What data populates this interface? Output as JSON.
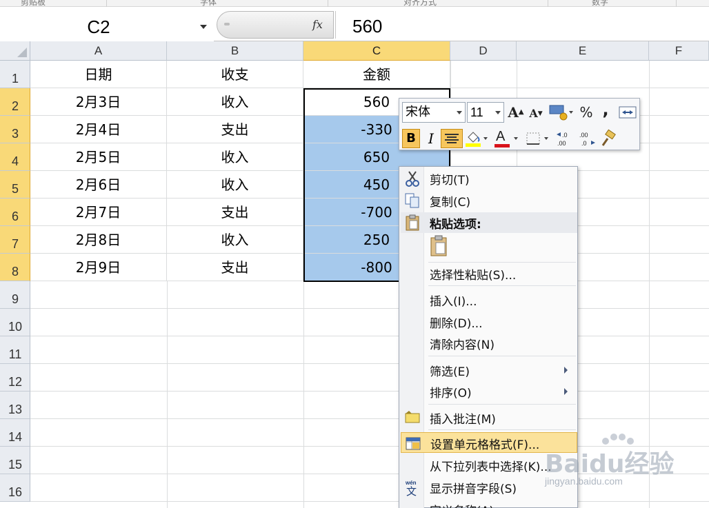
{
  "ribbon": {
    "groups": [
      "剪贴板",
      "字体",
      "对齐方式",
      "数字"
    ]
  },
  "formula_bar": {
    "name_box": "C2",
    "fx_label": "fx",
    "value": "560"
  },
  "grid": {
    "columns": [
      "A",
      "B",
      "C",
      "D",
      "E",
      "F"
    ],
    "rows": [
      "1",
      "2",
      "3",
      "4",
      "5",
      "6",
      "7",
      "8",
      "9",
      "10",
      "11",
      "12",
      "13",
      "14",
      "15",
      "16"
    ],
    "data": [
      [
        "日期",
        "收支",
        "金额"
      ],
      [
        "2月3日",
        "收入",
        "560"
      ],
      [
        "2月4日",
        "支出",
        "-330"
      ],
      [
        "2月5日",
        "收入",
        "650"
      ],
      [
        "2月6日",
        "收入",
        "450"
      ],
      [
        "2月7日",
        "支出",
        "-700"
      ],
      [
        "2月8日",
        "收入",
        "250"
      ],
      [
        "2月9日",
        "支出",
        "-800"
      ]
    ]
  },
  "mini_toolbar": {
    "font_name": "宋体",
    "font_size": "11",
    "grow_font": "A",
    "shrink_font": "A",
    "percent": "%",
    "comma": ",",
    "bold": "B",
    "italic": "I",
    "font_color_letter": "A"
  },
  "context_menu": {
    "cut": "剪切(T)",
    "copy": "复制(C)",
    "paste_options": "粘贴选项:",
    "paste_special": "选择性粘贴(S)...",
    "insert": "插入(I)...",
    "delete": "删除(D)...",
    "clear_contents": "清除内容(N)",
    "filter": "筛选(E)",
    "sort": "排序(O)",
    "insert_comment": "插入批注(M)",
    "format_cells": "设置单元格格式(F)...",
    "pick_from_list": "从下拉列表中选择(K)...",
    "show_phonetic": "显示拼音字段(S)",
    "define_name": "定义名称(A)..."
  },
  "watermark": {
    "logo": "Baidu经验",
    "sub": "jingyan.baidu.com"
  },
  "colors": {
    "selection": "#a6c9ec",
    "header_selected": "#f9d978",
    "menu_hover": "#fbe29b"
  }
}
